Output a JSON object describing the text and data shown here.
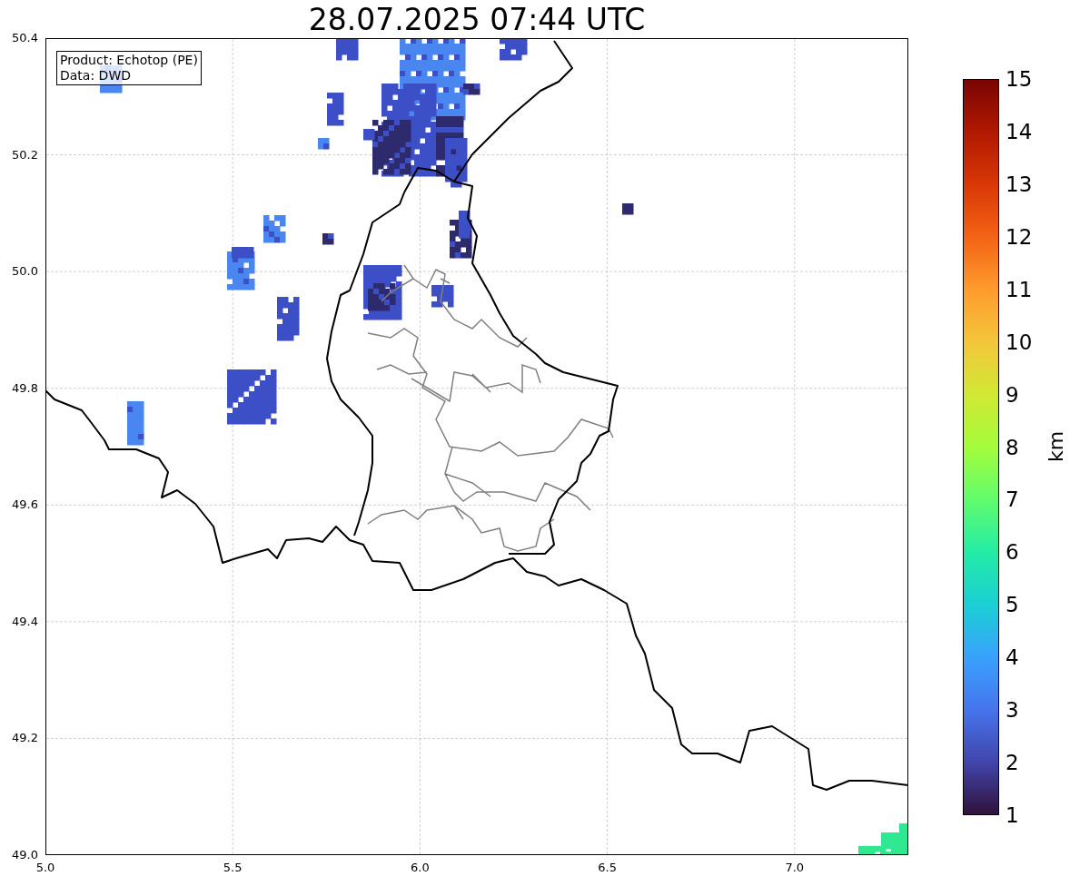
{
  "title": "28.07.2025 07:44 UTC",
  "info_box": {
    "lines": [
      "Product: Echotop (PE)",
      "Data: DWD"
    ]
  },
  "x_ticks": [
    "5.0",
    "5.5",
    "6.0",
    "6.5",
    "7.0"
  ],
  "y_ticks": [
    "50.4",
    "50.2",
    "50.0",
    "49.8",
    "49.6",
    "49.4",
    "49.2",
    "49.0"
  ],
  "colorbar": {
    "label": "km",
    "ticks": [
      "15",
      "14",
      "13",
      "12",
      "11",
      "10",
      "9",
      "8",
      "7",
      "6",
      "5",
      "4",
      "3",
      "2",
      "1"
    ]
  }
}
